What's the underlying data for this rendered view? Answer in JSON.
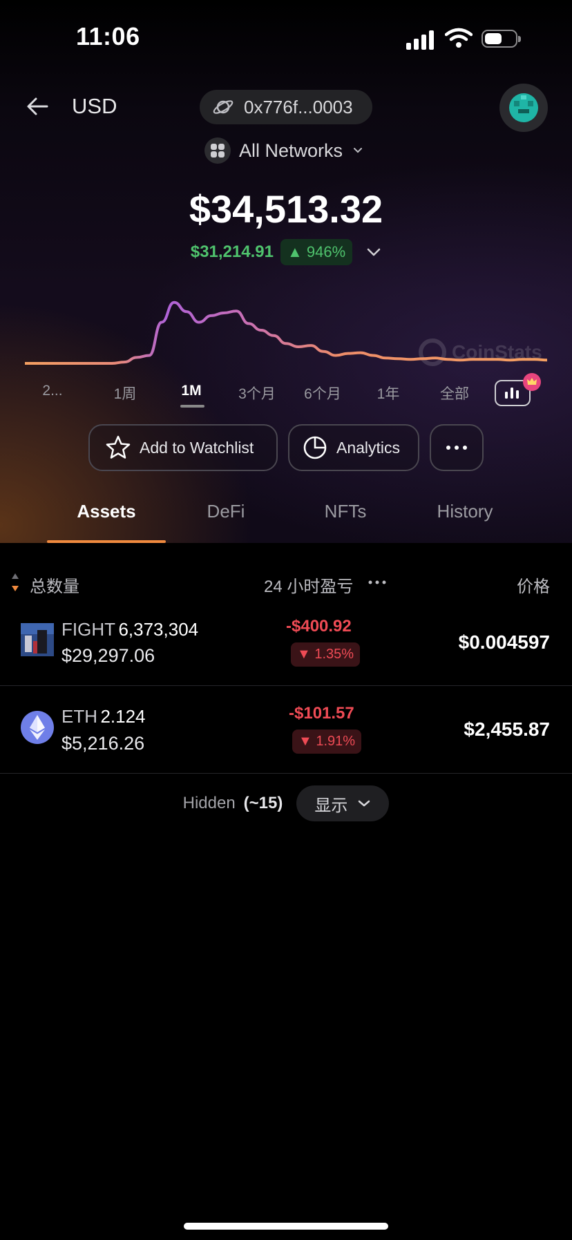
{
  "status_bar": {
    "time": "11:06"
  },
  "header": {
    "currency": "USD",
    "wallet_address": "0x776f...0003",
    "network_label": "All Networks"
  },
  "portfolio": {
    "total_value": "$34,513.32",
    "pnl_value": "$31,214.91",
    "pnl_percent": "946%"
  },
  "watermark": "CoinStats",
  "time_ranges": [
    {
      "label": "2..."
    },
    {
      "label": "1周"
    },
    {
      "label": "1M",
      "active": true
    },
    {
      "label": "3个月"
    },
    {
      "label": "6个月"
    },
    {
      "label": "1年"
    },
    {
      "label": "全部"
    }
  ],
  "actions": {
    "watchlist": "Add to Watchlist",
    "analytics": "Analytics"
  },
  "tabs": [
    {
      "label": "Assets",
      "active": true
    },
    {
      "label": "DeFi"
    },
    {
      "label": "NFTs"
    },
    {
      "label": "History"
    }
  ],
  "table": {
    "col_amount": "总数量",
    "col_pnl": "24 小时盈亏",
    "col_price": "价格"
  },
  "assets": [
    {
      "symbol": "FIGHT",
      "quantity": "6,373,304",
      "value": "$29,297.06",
      "pnl": "-$400.92",
      "pnl_percent": "1.35%",
      "price": "$0.004597",
      "icon": "fight-token-icon"
    },
    {
      "symbol": "ETH",
      "quantity": "2.124",
      "value": "$5,216.26",
      "pnl": "-$101.57",
      "pnl_percent": "1.91%",
      "price": "$2,455.87",
      "icon": "ethereum-icon"
    }
  ],
  "hidden": {
    "label": "Hidden",
    "count": "(~15)",
    "show_label": "显示"
  },
  "colors": {
    "accent": "#f08a3e",
    "gain": "#4fc36d",
    "loss": "#ef4b55",
    "chart_start": "#f5a061",
    "chart_peak": "#b063d8"
  },
  "chart_data": {
    "type": "line",
    "series": [
      {
        "values": [
          0,
          0,
          0,
          0,
          0,
          0,
          0,
          0,
          0.02,
          0.09,
          0.12,
          0.62,
          0.92,
          0.78,
          0.62,
          0.72,
          0.76,
          0.79,
          0.6,
          0.5,
          0.42,
          0.3,
          0.25,
          0.27,
          0.18,
          0.12,
          0.15,
          0.16,
          0.12,
          0.08,
          0.07,
          0.06,
          0.07,
          0.08,
          0.06,
          0.05,
          0.06,
          0.06,
          0.06,
          0.05,
          0.06,
          0.06,
          0.05
        ]
      }
    ],
    "xlabel": "",
    "ylabel": "",
    "grid": false
  }
}
